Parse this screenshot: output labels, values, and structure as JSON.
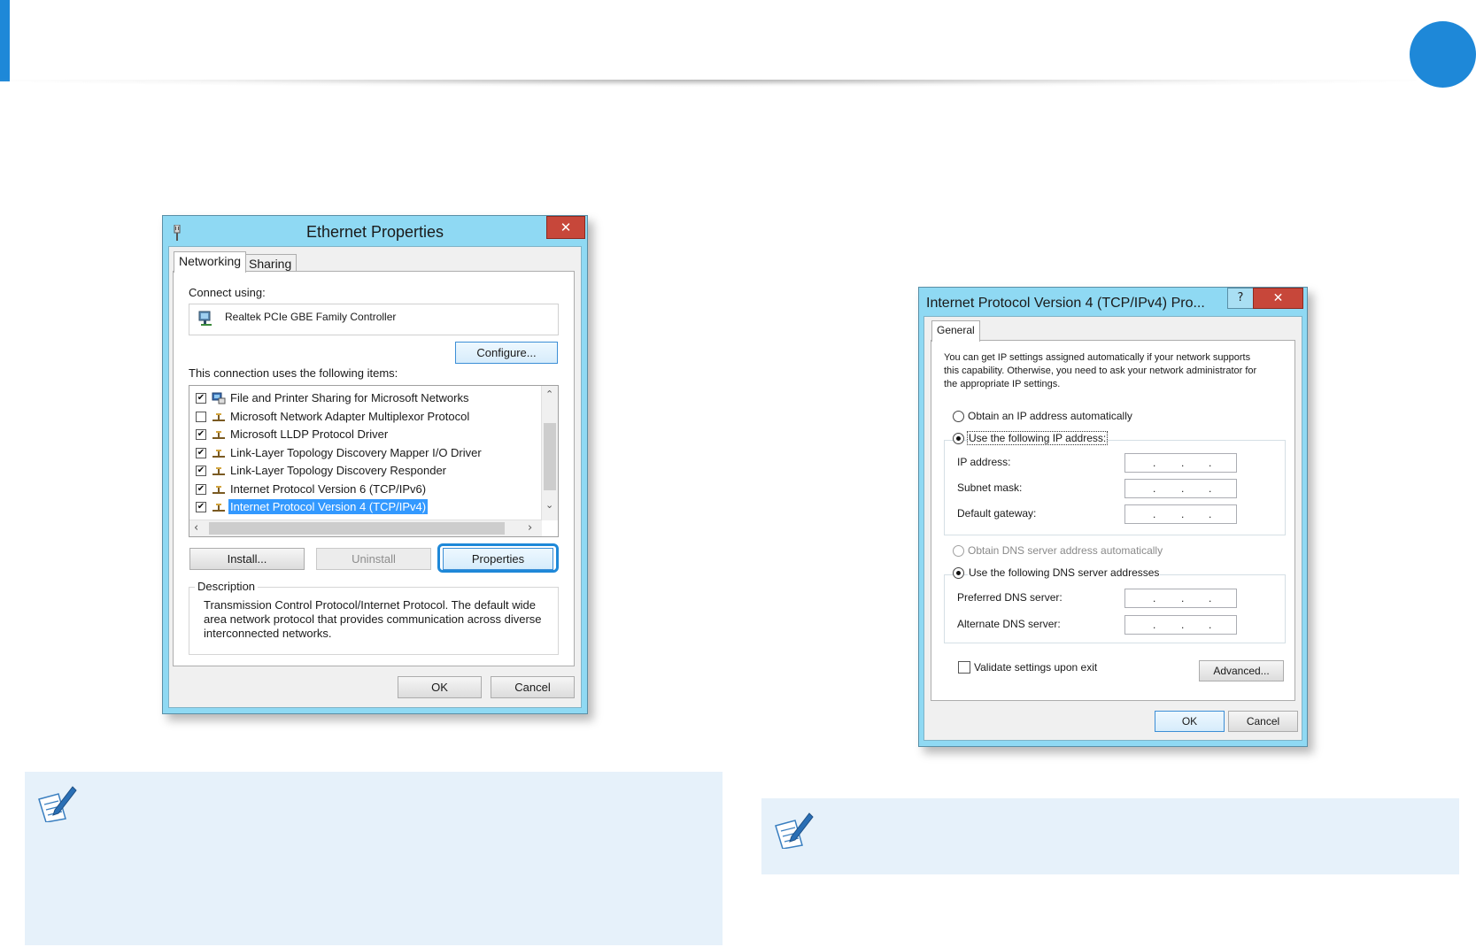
{
  "ethernet_dialog": {
    "title": "Ethernet Properties",
    "close_glyph": "✕",
    "tabs": [
      {
        "label": "Networking"
      },
      {
        "label": "Sharing"
      }
    ],
    "connect_using_label": "Connect using:",
    "adapter_name": "Realtek PCIe GBE Family Controller",
    "configure_button": "Configure...",
    "items_label": "This connection uses the following items:",
    "items": [
      {
        "label": "File and Printer Sharing for Microsoft Networks",
        "checked": true
      },
      {
        "label": "Microsoft Network Adapter Multiplexor Protocol",
        "checked": false
      },
      {
        "label": "Microsoft LLDP Protocol Driver",
        "checked": true
      },
      {
        "label": "Link-Layer Topology Discovery Mapper I/O Driver",
        "checked": true
      },
      {
        "label": "Link-Layer Topology Discovery Responder",
        "checked": true
      },
      {
        "label": "Internet Protocol Version 6 (TCP/IPv6)",
        "checked": true
      },
      {
        "label": "Internet Protocol Version 4 (TCP/IPv4)",
        "checked": true,
        "selected": true
      }
    ],
    "install_button": "Install...",
    "uninstall_button": "Uninstall",
    "properties_button": "Properties",
    "description_label": "Description",
    "description_text": "Transmission Control Protocol/Internet Protocol. The default wide area network protocol that provides communication across diverse interconnected networks.",
    "ok_button": "OK",
    "cancel_button": "Cancel"
  },
  "ipv4_dialog": {
    "title": "Internet Protocol Version 4 (TCP/IPv4) Pro...",
    "help_glyph": "?",
    "close_glyph": "✕",
    "tab_general": "General",
    "intro_text": "You can get IP settings assigned automatically if your network supports this capability. Otherwise, you need to ask your network administrator for the appropriate IP settings.",
    "obtain_ip_auto": "Obtain an IP address automatically",
    "use_following_ip": "Use the following IP address:",
    "ip_address_label": "IP address:",
    "subnet_mask_label": "Subnet mask:",
    "default_gateway_label": "Default gateway:",
    "ip_dots": ".",
    "obtain_dns_auto": "Obtain DNS server address automatically",
    "use_following_dns": "Use the following DNS server addresses",
    "preferred_dns_label": "Preferred DNS server:",
    "alternate_dns_label": "Alternate DNS server:",
    "validate_label": "Validate settings upon exit",
    "advanced_button": "Advanced...",
    "ok_button": "OK",
    "cancel_button": "Cancel"
  },
  "colors": {
    "accent": "#1e88d8",
    "dialog_frame": "#8fd9f3",
    "close_red": "#c7473a",
    "selection": "#3399ff",
    "note_bg": "#e6f1fa"
  }
}
